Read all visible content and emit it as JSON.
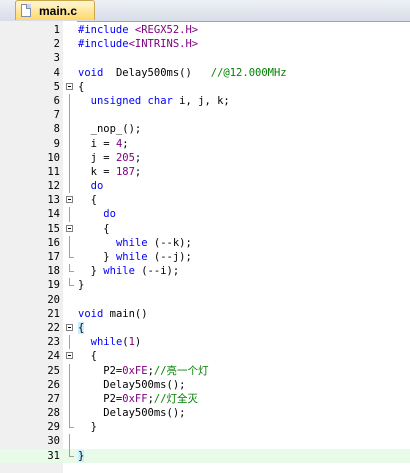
{
  "tab": {
    "filename": "main.c",
    "icon": "c-file-icon"
  },
  "colors": {
    "keyword": "#0000ff",
    "number": "#800080",
    "comment": "#008000",
    "highlight_line": "#e8fbe8"
  },
  "lines": [
    {
      "n": "1",
      "fold": "",
      "tokens": [
        [
          "pp",
          "#include "
        ],
        [
          "str",
          "<REGX52.H>"
        ]
      ]
    },
    {
      "n": "2",
      "fold": "",
      "tokens": [
        [
          "pp",
          "#include"
        ],
        [
          "str",
          "<INTRINS.H>"
        ]
      ]
    },
    {
      "n": "3",
      "fold": "",
      "tokens": []
    },
    {
      "n": "4",
      "fold": "",
      "tokens": [
        [
          "kw",
          "void"
        ],
        [
          "",
          "  Delay500ms()   "
        ],
        [
          "cm",
          "//@12.000MHz"
        ]
      ]
    },
    {
      "n": "5",
      "fold": "box",
      "tokens": [
        [
          "",
          "{"
        ]
      ]
    },
    {
      "n": "6",
      "fold": "vl",
      "tokens": [
        [
          "",
          "  "
        ],
        [
          "kw",
          "unsigned char"
        ],
        [
          "",
          " i, j, k;"
        ]
      ]
    },
    {
      "n": "7",
      "fold": "vl",
      "tokens": []
    },
    {
      "n": "8",
      "fold": "vl",
      "tokens": [
        [
          "",
          "  _nop_();"
        ]
      ]
    },
    {
      "n": "9",
      "fold": "vl",
      "tokens": [
        [
          "",
          "  i = "
        ],
        [
          "num",
          "4"
        ],
        [
          "",
          ";"
        ]
      ]
    },
    {
      "n": "10",
      "fold": "vl",
      "tokens": [
        [
          "",
          "  j = "
        ],
        [
          "num",
          "205"
        ],
        [
          "",
          ";"
        ]
      ]
    },
    {
      "n": "11",
      "fold": "vl",
      "tokens": [
        [
          "",
          "  k = "
        ],
        [
          "num",
          "187"
        ],
        [
          "",
          ";"
        ]
      ]
    },
    {
      "n": "12",
      "fold": "vl",
      "tokens": [
        [
          "",
          "  "
        ],
        [
          "kw",
          "do"
        ]
      ]
    },
    {
      "n": "13",
      "fold": "box",
      "tokens": [
        [
          "",
          "  {"
        ]
      ]
    },
    {
      "n": "14",
      "fold": "vl",
      "tokens": [
        [
          "",
          "    "
        ],
        [
          "kw",
          "do"
        ]
      ]
    },
    {
      "n": "15",
      "fold": "box",
      "tokens": [
        [
          "",
          "    {"
        ]
      ]
    },
    {
      "n": "16",
      "fold": "vl",
      "tokens": [
        [
          "",
          "      "
        ],
        [
          "kw",
          "while"
        ],
        [
          "",
          " (--k);"
        ]
      ]
    },
    {
      "n": "17",
      "fold": "el",
      "tokens": [
        [
          "",
          "    } "
        ],
        [
          "kw",
          "while"
        ],
        [
          "",
          " (--j);"
        ]
      ]
    },
    {
      "n": "18",
      "fold": "el",
      "tokens": [
        [
          "",
          "  } "
        ],
        [
          "kw",
          "while"
        ],
        [
          "",
          " (--i);"
        ]
      ]
    },
    {
      "n": "19",
      "fold": "el",
      "tokens": [
        [
          "",
          "}"
        ]
      ]
    },
    {
      "n": "20",
      "fold": "",
      "tokens": []
    },
    {
      "n": "21",
      "fold": "",
      "tokens": [
        [
          "kw",
          "void"
        ],
        [
          "",
          " main()"
        ]
      ]
    },
    {
      "n": "22",
      "fold": "box",
      "tokens": [
        [
          "brace",
          "{"
        ]
      ]
    },
    {
      "n": "23",
      "fold": "vl",
      "tokens": [
        [
          "",
          "  "
        ],
        [
          "kw",
          "while"
        ],
        [
          "",
          "("
        ],
        [
          "num",
          "1"
        ],
        [
          "",
          ")"
        ]
      ]
    },
    {
      "n": "24",
      "fold": "box",
      "tokens": [
        [
          "",
          "  {"
        ]
      ]
    },
    {
      "n": "25",
      "fold": "vl",
      "tokens": [
        [
          "",
          "    P2="
        ],
        [
          "num",
          "0xFE"
        ],
        [
          "",
          ";"
        ],
        [
          "cm",
          "//亮一个灯"
        ]
      ]
    },
    {
      "n": "26",
      "fold": "vl",
      "tokens": [
        [
          "",
          "    Delay500ms();"
        ]
      ]
    },
    {
      "n": "27",
      "fold": "vl",
      "tokens": [
        [
          "",
          "    P2="
        ],
        [
          "num",
          "0xFF"
        ],
        [
          "",
          ";"
        ],
        [
          "cm",
          "//灯全灭"
        ]
      ]
    },
    {
      "n": "28",
      "fold": "vl",
      "tokens": [
        [
          "",
          "    Delay500ms();"
        ]
      ]
    },
    {
      "n": "29",
      "fold": "el",
      "tokens": [
        [
          "",
          "  }"
        ]
      ]
    },
    {
      "n": "30",
      "fold": "vl",
      "tokens": []
    },
    {
      "n": "31",
      "fold": "el",
      "tokens": [
        [
          "brace",
          "}"
        ]
      ],
      "highlight": true
    }
  ]
}
